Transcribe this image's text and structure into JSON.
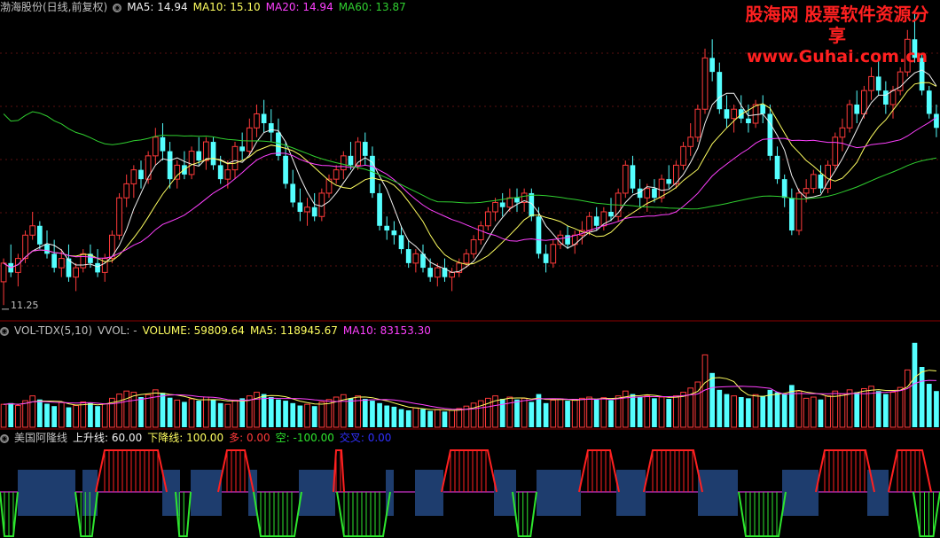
{
  "colors": {
    "bg": "#000000",
    "divider": "#8b0000",
    "grid": "#5a1010",
    "up": "#ff3a3a",
    "down": "#54ffff",
    "ma5": "#f0f0f0",
    "ma10": "#ffff60",
    "ma20": "#ff40ff",
    "ma60": "#30d030",
    "block": "#1e3d6e",
    "green": "#2ee62e",
    "red": "#ff2020",
    "label": "#c0c0c0",
    "blue": "#3030ff"
  },
  "watermark": {
    "line1": "股海网 股票软件资源分享",
    "line2": "www.Guhai.com.cn"
  },
  "panel1": {
    "title": "渤海股份(日线,前复权)",
    "ma5": "MA5: 14.94",
    "ma10": "MA10: 15.10",
    "ma20": "MA20: 14.94",
    "ma60": "MA60: 13.87",
    "low_label": "11.25"
  },
  "panel2": {
    "title": "VOL-TDX(5,10)",
    "vvol": "VVOL: -",
    "volume": "VOLUME: 59809.64",
    "ma5": "MA5: 118945.67",
    "ma10": "MA10: 83153.30"
  },
  "panel3": {
    "title": "美国阿隆线",
    "up": "上升线: 60.00",
    "down": "下降线: 100.00",
    "duo": "多: 0.00",
    "kong": "空: -100.00",
    "jiaocha": "交叉: 0.00"
  },
  "chart_data": [
    {
      "type": "candlestick",
      "title": "渤海股份(日线,前复权)",
      "price_range": [
        11.0,
        17.5
      ],
      "low_marker": 11.25,
      "ohlc": [
        [
          11.8,
          12.3,
          11.3,
          12.2
        ],
        [
          12.2,
          12.6,
          11.9,
          12.0
        ],
        [
          12.0,
          12.4,
          11.7,
          12.3
        ],
        [
          12.3,
          12.9,
          12.2,
          12.8
        ],
        [
          12.8,
          13.3,
          12.7,
          13.0
        ],
        [
          13.0,
          13.1,
          12.5,
          12.6
        ],
        [
          12.6,
          12.9,
          12.3,
          12.4
        ],
        [
          12.4,
          12.7,
          12.0,
          12.1
        ],
        [
          12.1,
          12.5,
          11.9,
          12.3
        ],
        [
          12.3,
          12.6,
          11.8,
          11.9
        ],
        [
          11.9,
          12.2,
          11.6,
          12.1
        ],
        [
          12.1,
          12.5,
          12.0,
          12.4
        ],
        [
          12.4,
          12.6,
          12.1,
          12.2
        ],
        [
          12.2,
          12.5,
          11.9,
          12.0
        ],
        [
          12.0,
          12.4,
          11.8,
          12.3
        ],
        [
          12.3,
          12.9,
          12.2,
          12.8
        ],
        [
          12.8,
          13.7,
          12.7,
          13.6
        ],
        [
          13.6,
          14.1,
          13.4,
          13.9
        ],
        [
          13.9,
          14.3,
          13.6,
          14.2
        ],
        [
          14.2,
          14.4,
          13.8,
          14.0
        ],
        [
          14.0,
          14.6,
          13.9,
          14.5
        ],
        [
          14.5,
          15.1,
          14.3,
          14.9
        ],
        [
          14.9,
          15.2,
          14.4,
          14.6
        ],
        [
          14.6,
          14.8,
          13.8,
          14.0
        ],
        [
          14.0,
          14.4,
          13.8,
          14.3
        ],
        [
          14.3,
          14.6,
          14.0,
          14.1
        ],
        [
          14.1,
          14.7,
          14.0,
          14.6
        ],
        [
          14.6,
          14.9,
          14.3,
          14.4
        ],
        [
          14.4,
          14.9,
          14.2,
          14.8
        ],
        [
          14.8,
          14.9,
          14.2,
          14.3
        ],
        [
          14.3,
          14.5,
          13.9,
          14.0
        ],
        [
          14.0,
          14.4,
          13.8,
          14.2
        ],
        [
          14.2,
          14.8,
          14.0,
          14.7
        ],
        [
          14.7,
          15.0,
          14.4,
          14.6
        ],
        [
          14.6,
          15.3,
          14.5,
          15.1
        ],
        [
          15.1,
          15.6,
          14.9,
          15.4
        ],
        [
          15.4,
          15.7,
          15.0,
          15.2
        ],
        [
          15.2,
          15.5,
          14.8,
          15.0
        ],
        [
          15.0,
          15.3,
          14.4,
          14.5
        ],
        [
          14.5,
          14.8,
          13.8,
          13.9
        ],
        [
          13.9,
          14.2,
          13.4,
          13.5
        ],
        [
          13.5,
          13.8,
          13.1,
          13.3
        ],
        [
          13.3,
          13.6,
          13.0,
          13.4
        ],
        [
          13.4,
          13.7,
          13.1,
          13.2
        ],
        [
          13.2,
          13.8,
          13.1,
          13.7
        ],
        [
          13.7,
          14.1,
          13.6,
          14.0
        ],
        [
          14.0,
          14.3,
          13.9,
          14.2
        ],
        [
          14.2,
          14.6,
          14.0,
          14.5
        ],
        [
          14.5,
          14.8,
          14.2,
          14.3
        ],
        [
          14.3,
          14.9,
          14.2,
          14.8
        ],
        [
          14.8,
          15.0,
          14.3,
          14.5
        ],
        [
          14.5,
          14.7,
          13.6,
          13.7
        ],
        [
          13.7,
          13.9,
          12.9,
          13.0
        ],
        [
          13.0,
          13.2,
          12.7,
          12.9
        ],
        [
          12.9,
          13.1,
          12.6,
          12.8
        ],
        [
          12.8,
          13.0,
          12.4,
          12.5
        ],
        [
          12.5,
          12.7,
          12.1,
          12.2
        ],
        [
          12.2,
          12.5,
          12.0,
          12.4
        ],
        [
          12.4,
          12.6,
          12.0,
          12.1
        ],
        [
          12.1,
          12.3,
          11.8,
          11.9
        ],
        [
          11.9,
          12.2,
          11.7,
          12.1
        ],
        [
          12.1,
          12.3,
          11.8,
          11.9
        ],
        [
          11.9,
          12.1,
          11.6,
          12.0
        ],
        [
          12.0,
          12.3,
          11.9,
          12.2
        ],
        [
          12.2,
          12.5,
          12.1,
          12.4
        ],
        [
          12.4,
          12.8,
          12.3,
          12.7
        ],
        [
          12.7,
          13.1,
          12.6,
          13.0
        ],
        [
          13.0,
          13.4,
          12.9,
          13.3
        ],
        [
          13.3,
          13.6,
          13.1,
          13.5
        ],
        [
          13.5,
          13.7,
          13.2,
          13.4
        ],
        [
          13.4,
          13.8,
          13.3,
          13.6
        ],
        [
          13.6,
          13.8,
          13.3,
          13.5
        ],
        [
          13.5,
          13.8,
          13.3,
          13.7
        ],
        [
          13.7,
          13.8,
          13.1,
          13.2
        ],
        [
          13.2,
          13.4,
          12.3,
          12.4
        ],
        [
          12.4,
          12.6,
          12.0,
          12.2
        ],
        [
          12.2,
          12.7,
          12.1,
          12.6
        ],
        [
          12.6,
          12.9,
          12.5,
          12.8
        ],
        [
          12.8,
          13.0,
          12.5,
          12.6
        ],
        [
          12.6,
          12.9,
          12.4,
          12.8
        ],
        [
          12.8,
          13.1,
          12.6,
          12.9
        ],
        [
          12.9,
          13.3,
          12.8,
          13.2
        ],
        [
          13.2,
          13.4,
          12.9,
          13.0
        ],
        [
          13.0,
          13.4,
          12.9,
          13.3
        ],
        [
          13.3,
          13.6,
          13.1,
          13.2
        ],
        [
          13.2,
          13.8,
          13.1,
          13.7
        ],
        [
          13.7,
          14.4,
          13.6,
          14.3
        ],
        [
          14.3,
          14.5,
          13.7,
          13.8
        ],
        [
          13.8,
          14.0,
          13.4,
          13.6
        ],
        [
          13.6,
          13.9,
          13.3,
          13.8
        ],
        [
          13.8,
          14.0,
          13.5,
          13.6
        ],
        [
          13.6,
          14.1,
          13.5,
          14.0
        ],
        [
          14.0,
          14.3,
          13.8,
          13.9
        ],
        [
          13.9,
          14.4,
          13.8,
          14.3
        ],
        [
          14.3,
          14.8,
          14.2,
          14.7
        ],
        [
          14.7,
          15.2,
          14.5,
          14.9
        ],
        [
          14.9,
          15.6,
          14.8,
          15.5
        ],
        [
          15.5,
          16.8,
          15.4,
          16.6
        ],
        [
          16.6,
          17.0,
          16.1,
          16.3
        ],
        [
          16.3,
          16.5,
          15.4,
          15.5
        ],
        [
          15.5,
          15.8,
          15.1,
          15.3
        ],
        [
          15.3,
          15.6,
          15.0,
          15.5
        ],
        [
          15.5,
          15.8,
          15.2,
          15.3
        ],
        [
          15.3,
          15.6,
          15.0,
          15.2
        ],
        [
          15.2,
          15.7,
          15.1,
          15.6
        ],
        [
          15.6,
          15.8,
          15.2,
          15.4
        ],
        [
          15.4,
          15.6,
          14.4,
          14.5
        ],
        [
          14.5,
          14.7,
          13.9,
          14.0
        ],
        [
          14.0,
          14.1,
          13.4,
          13.6
        ],
        [
          13.6,
          13.8,
          12.8,
          12.9
        ],
        [
          12.9,
          13.8,
          12.8,
          13.7
        ],
        [
          13.7,
          14.0,
          13.5,
          13.8
        ],
        [
          13.8,
          14.2,
          13.7,
          14.1
        ],
        [
          14.1,
          14.3,
          13.7,
          13.8
        ],
        [
          13.8,
          14.4,
          13.7,
          14.3
        ],
        [
          14.3,
          15.0,
          14.2,
          14.9
        ],
        [
          14.9,
          15.3,
          14.6,
          15.1
        ],
        [
          15.1,
          15.7,
          15.0,
          15.6
        ],
        [
          15.6,
          15.9,
          15.2,
          15.4
        ],
        [
          15.4,
          16.0,
          15.3,
          15.9
        ],
        [
          15.9,
          16.4,
          15.7,
          16.2
        ],
        [
          16.2,
          16.6,
          15.8,
          15.9
        ],
        [
          15.9,
          16.1,
          15.4,
          15.6
        ],
        [
          15.6,
          16.0,
          15.3,
          15.9
        ],
        [
          15.9,
          16.4,
          15.8,
          16.3
        ],
        [
          16.3,
          17.2,
          16.2,
          17.0
        ],
        [
          17.0,
          17.6,
          16.5,
          16.6
        ],
        [
          16.6,
          16.7,
          15.8,
          15.9
        ],
        [
          15.9,
          16.0,
          15.3,
          15.4
        ],
        [
          15.4,
          15.6,
          14.9,
          15.1
        ]
      ]
    },
    {
      "type": "bar",
      "title": "VOL-TDX(5,10)",
      "volumes": [
        38,
        40,
        36,
        44,
        52,
        46,
        39,
        35,
        41,
        33,
        36,
        42,
        40,
        35,
        39,
        48,
        55,
        60,
        58,
        50,
        54,
        62,
        57,
        49,
        45,
        42,
        47,
        44,
        50,
        46,
        40,
        38,
        45,
        48,
        52,
        58,
        55,
        50,
        46,
        44,
        40,
        36,
        38,
        35,
        42,
        46,
        50,
        54,
        48,
        52,
        47,
        44,
        40,
        36,
        34,
        30,
        28,
        32,
        30,
        27,
        29,
        26,
        28,
        31,
        35,
        40,
        44,
        48,
        52,
        47,
        50,
        46,
        48,
        42,
        55,
        40,
        45,
        47,
        44,
        46,
        48,
        50,
        46,
        49,
        45,
        52,
        60,
        55,
        50,
        52,
        48,
        50,
        47,
        52,
        58,
        65,
        75,
        120,
        90,
        62,
        55,
        52,
        50,
        48,
        54,
        52,
        62,
        58,
        55,
        70,
        60,
        48,
        50,
        46,
        52,
        60,
        55,
        62,
        58,
        64,
        68,
        60,
        55,
        58,
        66,
        95,
        140,
        100,
        72,
        60
      ],
      "ylim": [
        0,
        150
      ]
    },
    {
      "type": "bar",
      "title": "美国阿隆线",
      "state_sequence": "上升线 / 下降线 / 多 / 空 / 交叉"
    }
  ]
}
